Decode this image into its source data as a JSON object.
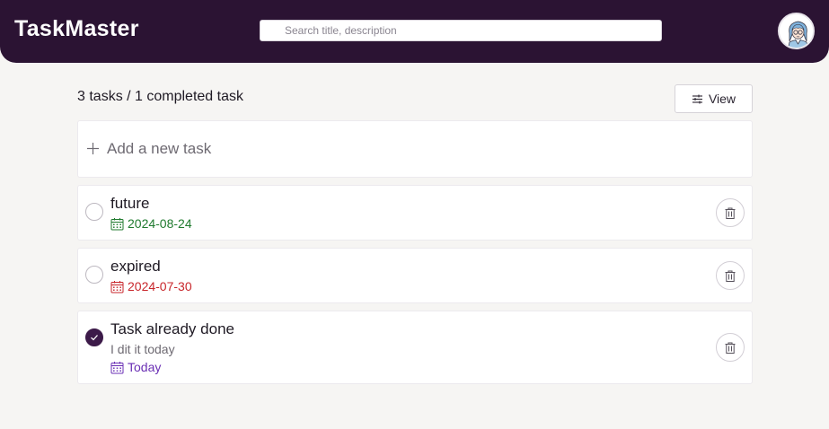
{
  "header": {
    "brand": "TaskMaster",
    "search_placeholder": "Search title, description",
    "search_value": "",
    "avatar_icon": "user-avatar-icon"
  },
  "summary": {
    "text": "3 tasks / 1 completed task",
    "view_label": "View",
    "view_icon": "sliders-icon"
  },
  "add_task": {
    "label": "Add a new task",
    "icon": "plus-icon"
  },
  "tasks": [
    {
      "title": "future",
      "description": "",
      "date": "2024-08-24",
      "status": "upcoming",
      "completed": false
    },
    {
      "title": "expired",
      "description": "",
      "date": "2024-07-30",
      "status": "overdue",
      "completed": false
    },
    {
      "title": "Task already done",
      "description": "I dit it today",
      "date": "Today",
      "status": "today",
      "completed": true
    }
  ],
  "colors": {
    "header_bg": "#2b1333",
    "accent": "#3c1a49",
    "upcoming_date": "#1f7a2e",
    "overdue_date": "#c8262b",
    "today_date": "#6a2fb4",
    "page_bg": "#f6f5f3"
  }
}
